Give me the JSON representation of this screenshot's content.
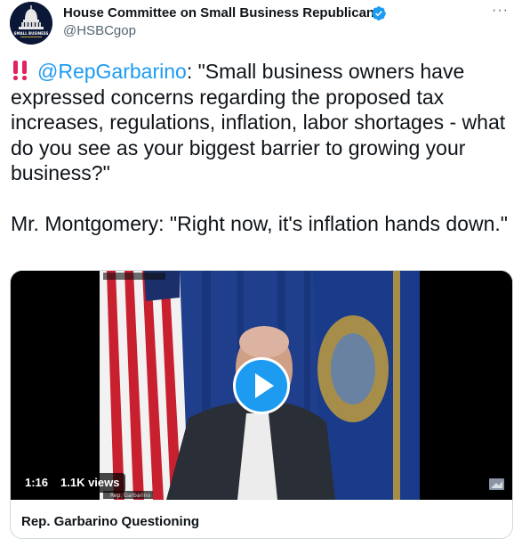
{
  "account": {
    "name": "House Committee on Small Business Republicans",
    "handle": "@HSBCgop",
    "verified": true,
    "avatar_icon": "capitol-dome-icon",
    "avatar_text": "SMALL BUSINESS"
  },
  "tweet": {
    "emoji_icon": "double-exclamation-icon",
    "mention": "@RepGarbarino",
    "text_1": ": \"Small business owners have expressed concerns regarding the proposed tax increases, regulations, inflation, labor shortages - what do you see as your biggest barrier to growing your business?\"",
    "text_2": "Mr. Montgomery: \"Right now, it's inflation hands down.\""
  },
  "media": {
    "duration": "1:16",
    "views": "1.1K views",
    "card_title": "Rep. Garbarino Questioning",
    "overlay_label": "Rep. Garbarino"
  },
  "colors": {
    "accent": "#1d9bf0",
    "text": "#0f1419",
    "secondary": "#536471",
    "border": "#cfd9de"
  }
}
